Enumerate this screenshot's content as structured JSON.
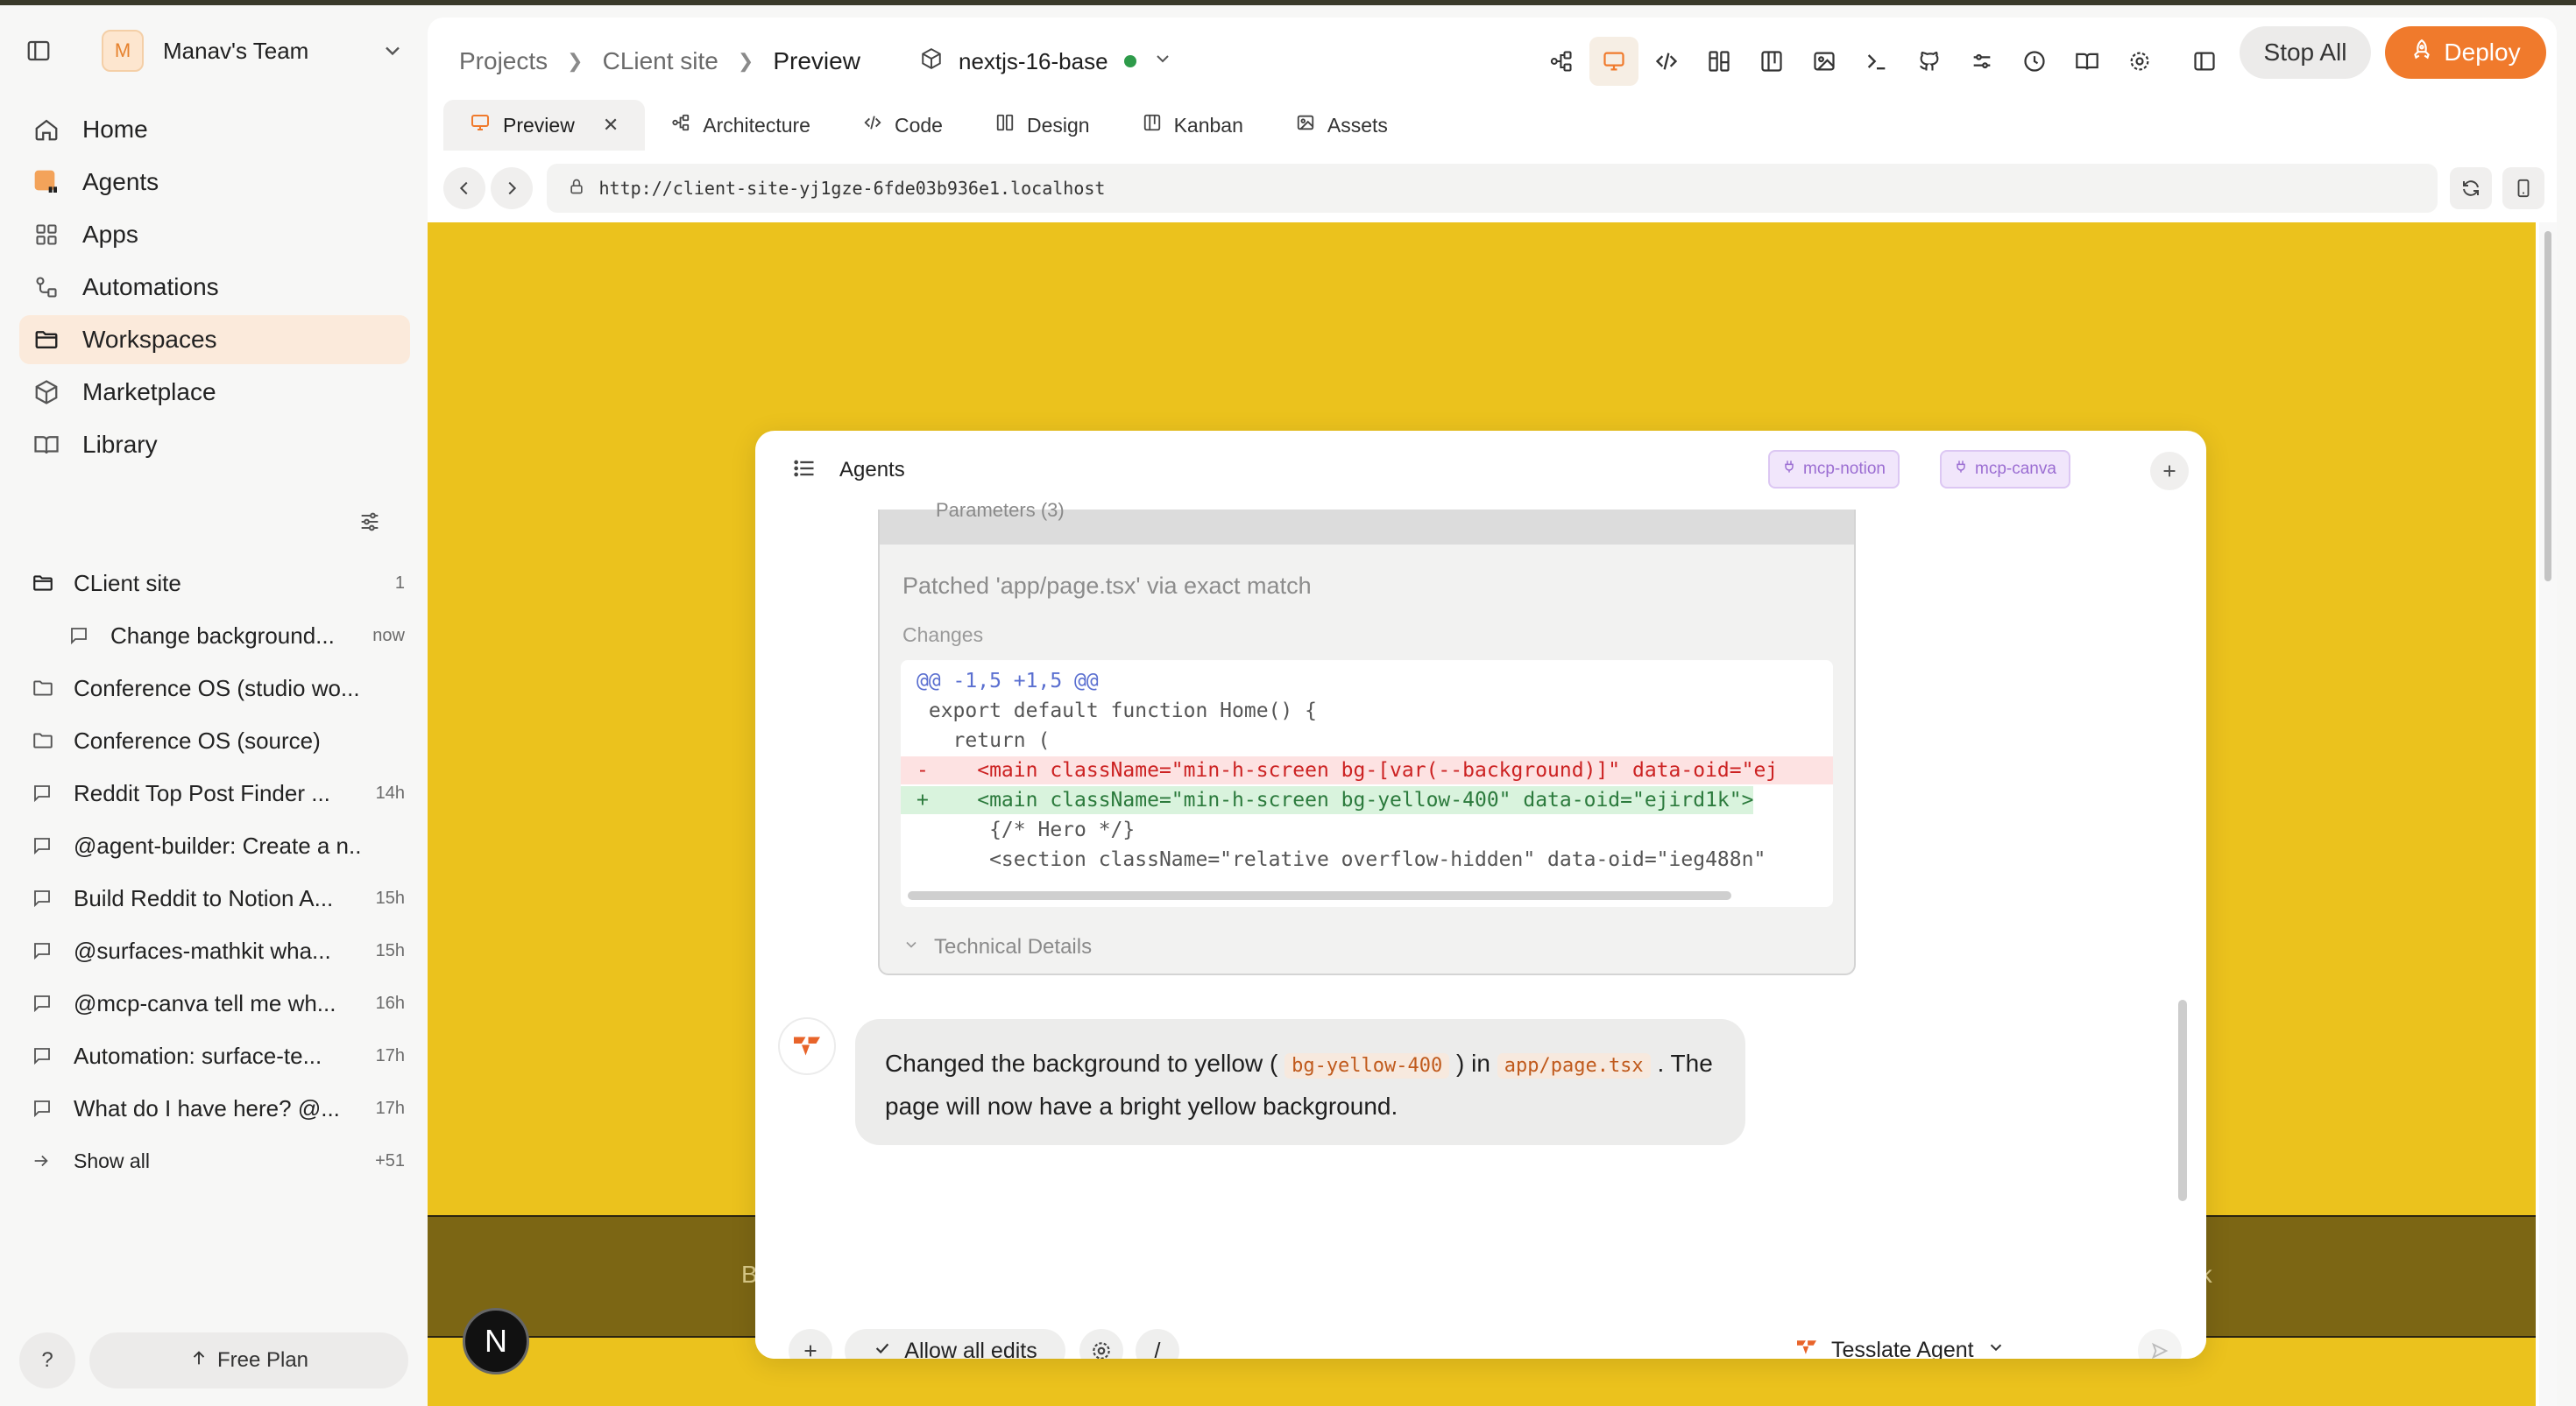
{
  "sidebar": {
    "team_initial": "M",
    "team_name": "Manav's Team",
    "nav": [
      {
        "label": "Home",
        "icon": "home-icon"
      },
      {
        "label": "Agents",
        "icon": "agents-icon"
      },
      {
        "label": "Apps",
        "icon": "apps-icon"
      },
      {
        "label": "Automations",
        "icon": "automations-icon"
      },
      {
        "label": "Workspaces",
        "icon": "folder-icon"
      },
      {
        "label": "Marketplace",
        "icon": "cube-icon"
      },
      {
        "label": "Library",
        "icon": "book-icon"
      }
    ],
    "tree": [
      {
        "label": "CLient site",
        "meta": "1"
      },
      {
        "label": "Change background...",
        "meta": "now"
      },
      {
        "label": "Conference OS (studio wo...",
        "meta": ""
      },
      {
        "label": "Conference OS (source)",
        "meta": ""
      },
      {
        "label": "Reddit Top Post Finder ...",
        "meta": "14h"
      },
      {
        "label": "@agent-builder: Create a n...",
        "meta": ""
      },
      {
        "label": "Build Reddit to Notion A...",
        "meta": "15h"
      },
      {
        "label": "@surfaces-mathkit wha...",
        "meta": "15h"
      },
      {
        "label": "@mcp-canva tell me wh...",
        "meta": "16h"
      },
      {
        "label": "Automation: surface-te...",
        "meta": "17h"
      },
      {
        "label": "What do I have here? @...",
        "meta": "17h"
      },
      {
        "label": "Show all",
        "meta": "+51"
      }
    ],
    "help_label": "?",
    "plan_label": "Free Plan"
  },
  "header": {
    "crumbs": [
      "Projects",
      "CLient site",
      "Preview"
    ],
    "repo": "nextjs-16-base",
    "stop_all": "Stop All",
    "deploy": "Deploy"
  },
  "tabs": [
    {
      "label": "Preview"
    },
    {
      "label": "Architecture"
    },
    {
      "label": "Code"
    },
    {
      "label": "Design"
    },
    {
      "label": "Kanban"
    },
    {
      "label": "Assets"
    }
  ],
  "url": "http://client-site-yj1gze-6fde03b936e1.localhost",
  "preview": {
    "footer_left": "B",
    "footer_right": "opack",
    "next_badge": "N"
  },
  "chat": {
    "title": "Agents",
    "mcp": [
      "mcp-notion",
      "mcp-canva"
    ],
    "tool": {
      "params_label": "Parameters (3)",
      "patched": "Patched 'app/page.tsx' via exact match",
      "changes_label": "Changes",
      "diff": [
        "@@ -1,5 +1,5 @@",
        " export default function Home() {",
        "   return (",
        "-    <main className=\"min-h-screen bg-[var(--background)]\" data-oid=\"ej",
        "+    <main className=\"min-h-screen bg-yellow-400\" data-oid=\"ejird1k\">",
        "      {/* Hero */}",
        "      <section className=\"relative overflow-hidden\" data-oid=\"ieg488n\""
      ],
      "tech_details": "Technical Details"
    },
    "message": {
      "p1": "Changed the background to yellow (",
      "c1": "bg-yellow-400",
      "p2": ") in",
      "c2": "app/page.tsx",
      "p3": ". The page will now have a bright yellow background."
    },
    "composer": {
      "allow_edits": "Allow all edits",
      "slash": "/",
      "agent": "Tesslate Agent"
    }
  },
  "colors": {
    "accent": "#f07a2c",
    "preview_bg": "#ebc21d",
    "footer_bg": "#7c6614"
  }
}
